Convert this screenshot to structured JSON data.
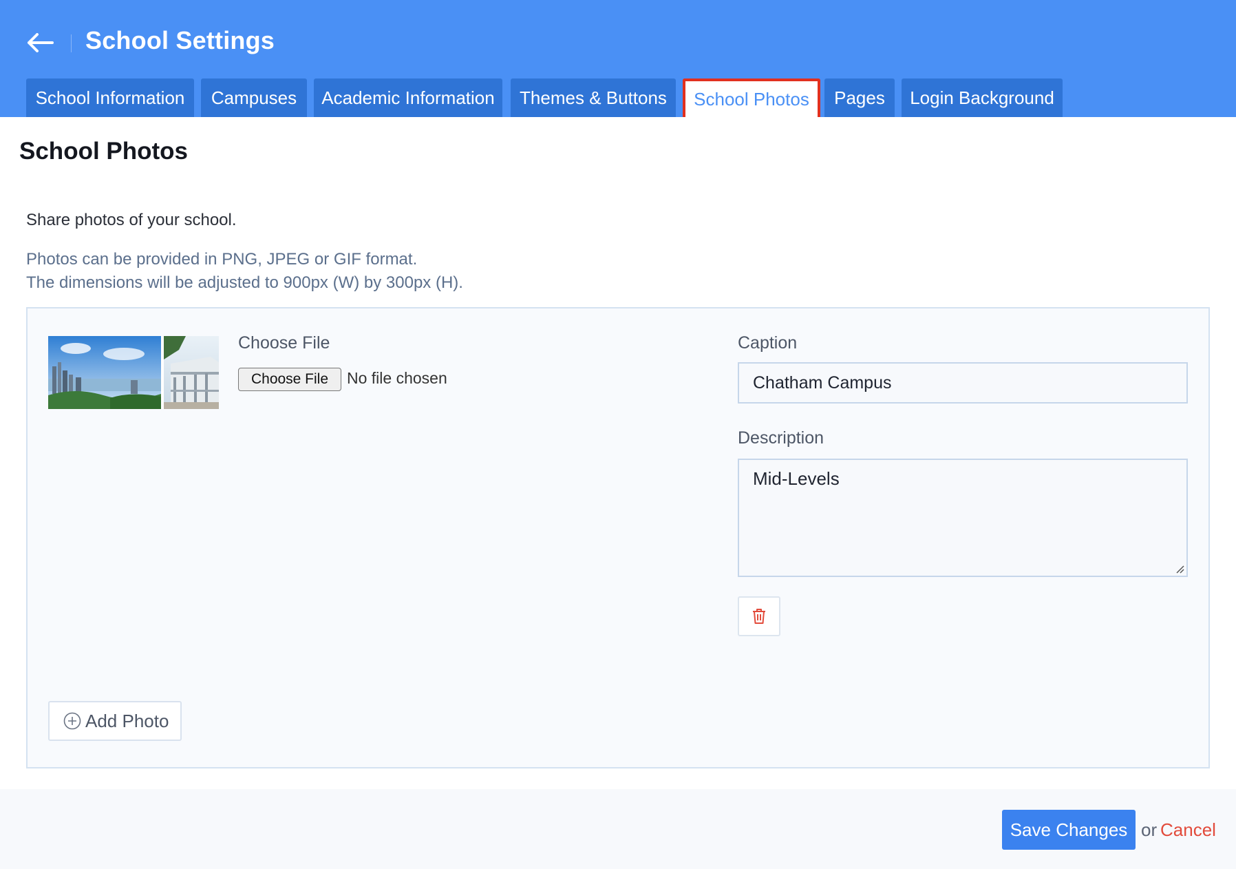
{
  "header": {
    "title": "School Settings",
    "back_icon": "arrow-left-icon"
  },
  "tabs": [
    {
      "label": "School Information",
      "active": false
    },
    {
      "label": "Campuses",
      "active": false
    },
    {
      "label": "Academic Information",
      "active": false
    },
    {
      "label": "Themes & Buttons",
      "active": false
    },
    {
      "label": "School Photos",
      "active": true
    },
    {
      "label": "Pages",
      "active": false
    },
    {
      "label": "Login Background",
      "active": false
    }
  ],
  "main": {
    "title": "School Photos",
    "intro": "Share photos of your school.",
    "hint_line1": "Photos can be provided in PNG, JPEG or GIF format.",
    "hint_line2": "The dimensions will be adjusted to 900px (W) by 300px (H)."
  },
  "photo": {
    "choose_label": "Choose File",
    "choose_button": "Choose File",
    "file_status": "No file chosen",
    "caption_label": "Caption",
    "caption_value": "Chatham Campus",
    "description_label": "Description",
    "description_value": "Mid-Levels",
    "delete_icon": "trash-icon"
  },
  "actions": {
    "add_photo": "Add Photo",
    "save": "Save Changes",
    "or": "or",
    "cancel": "Cancel"
  },
  "colors": {
    "header_bg": "#4a90f5",
    "tab_bg": "#2f74d6",
    "active_tab_border": "#e1301f",
    "save_bg": "#3b82ef",
    "cancel": "#e24b3b",
    "delete_icon": "#e24b3b"
  }
}
